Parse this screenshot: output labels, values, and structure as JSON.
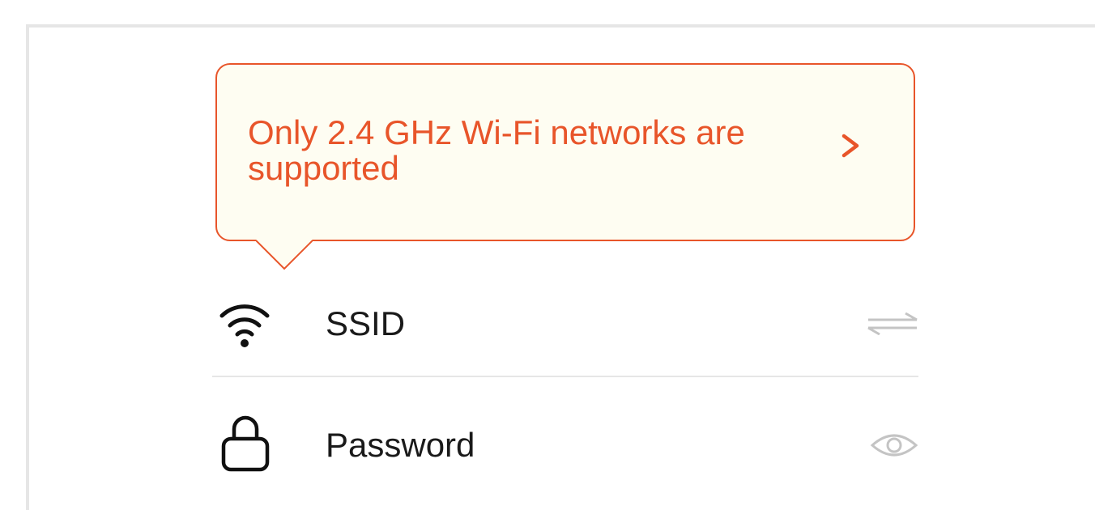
{
  "tooltip": {
    "message": "Only 2.4 GHz Wi-Fi networks are supported"
  },
  "ssid_row": {
    "icon": "wifi-icon",
    "label": "SSID",
    "action_icon": "swap-icon"
  },
  "password_row": {
    "icon": "lock-icon",
    "label": "Password",
    "action_icon": "eye-icon"
  },
  "colors": {
    "accent": "#e8552a",
    "tooltip_bg": "#fefdf2",
    "text": "#1a1a1a",
    "muted_icon": "#c4c4c4",
    "divider": "#e6e6e6"
  }
}
